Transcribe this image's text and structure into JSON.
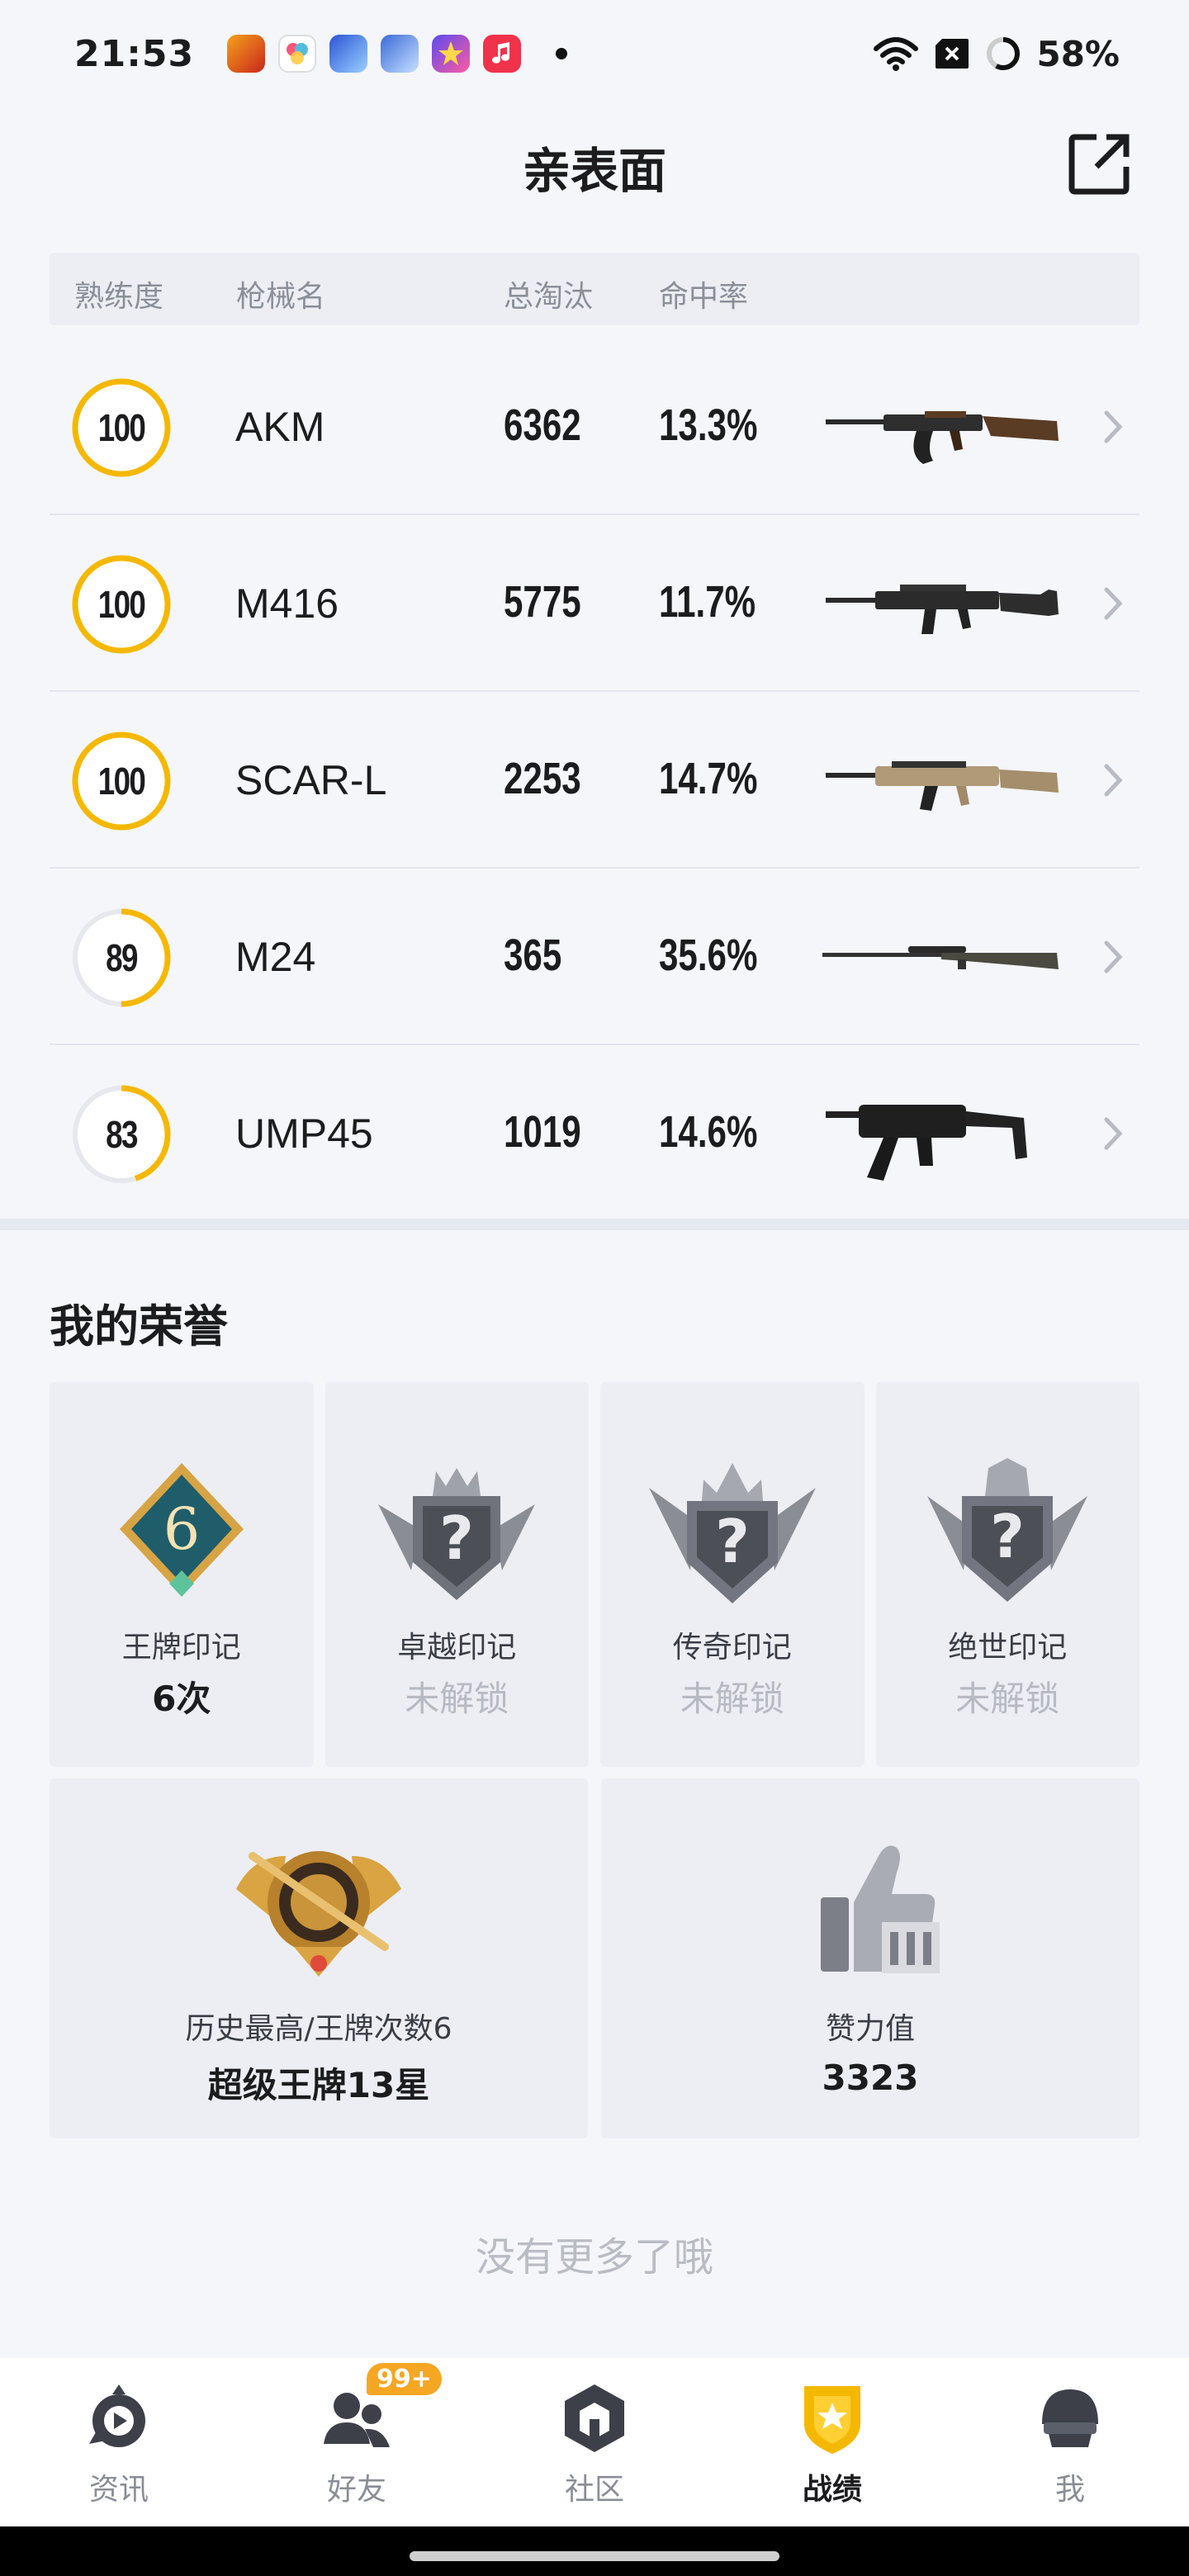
{
  "status_bar": {
    "time": "21:53",
    "battery": "58%",
    "app_icons": [
      "game-app-icon",
      "album-app-icon",
      "game-app-icon-2",
      "game-app-icon-3",
      "star-app-icon",
      "music-app-icon"
    ],
    "system_icons": [
      "wifi-icon",
      "sim-off-icon",
      "battery-ring-icon"
    ]
  },
  "header": {
    "title": "亲表面",
    "share_icon": "share-external-icon"
  },
  "weapons": {
    "columns": {
      "proficiency": "熟练度",
      "name": "枪械名",
      "kills": "总淘汰",
      "accuracy": "命中率"
    },
    "rows": [
      {
        "level": "100",
        "progress": 1.0,
        "name": "AKM",
        "kills": "6362",
        "accuracy": "13.3%",
        "image": "akm-rifle-image"
      },
      {
        "level": "100",
        "progress": 1.0,
        "name": "M416",
        "kills": "5775",
        "accuracy": "11.7%",
        "image": "m416-rifle-image"
      },
      {
        "level": "100",
        "progress": 1.0,
        "name": "SCAR-L",
        "kills": "2253",
        "accuracy": "14.7%",
        "image": "scar-l-rifle-image"
      },
      {
        "level": "89",
        "progress": 0.5,
        "name": "M24",
        "kills": "365",
        "accuracy": "35.6%",
        "image": "m24-sniper-image"
      },
      {
        "level": "83",
        "progress": 0.45,
        "name": "UMP45",
        "kills": "1019",
        "accuracy": "14.6%",
        "image": "ump45-smg-image"
      }
    ]
  },
  "honors": {
    "title": "我的荣誉",
    "badges": [
      {
        "name": "王牌印记",
        "value": "6次",
        "locked": false,
        "icon": "ace-mark-badge-icon",
        "badge_number": "6"
      },
      {
        "name": "卓越印记",
        "value": "未解锁",
        "locked": true,
        "icon": "excellence-mark-locked-icon"
      },
      {
        "name": "传奇印记",
        "value": "未解锁",
        "locked": true,
        "icon": "legend-mark-locked-icon"
      },
      {
        "name": "绝世印记",
        "value": "未解锁",
        "locked": true,
        "icon": "peerless-mark-locked-icon"
      }
    ],
    "cards": [
      {
        "label": "历史最高/王牌次数6",
        "value": "超级王牌13星",
        "icon": "super-ace-rank-icon"
      },
      {
        "label": "赞力值",
        "value": "3323",
        "icon": "thumbs-up-icon"
      }
    ]
  },
  "footer_text": "没有更多了哦",
  "bottom_nav": {
    "items": [
      {
        "label": "资讯",
        "icon": "news-play-icon",
        "active": false
      },
      {
        "label": "好友",
        "icon": "friends-icon",
        "active": false,
        "badge": "99+"
      },
      {
        "label": "社区",
        "icon": "community-icon",
        "active": false
      },
      {
        "label": "战绩",
        "icon": "record-shield-icon",
        "active": true
      },
      {
        "label": "我",
        "icon": "helmet-profile-icon",
        "active": false
      }
    ]
  },
  "colors": {
    "accent": "#f5b800",
    "ring_track": "#e6e8ed",
    "text_primary": "#1c1c1f",
    "text_secondary": "#8b8f99",
    "background": "#f4f6fa",
    "card": "#eceef3"
  }
}
